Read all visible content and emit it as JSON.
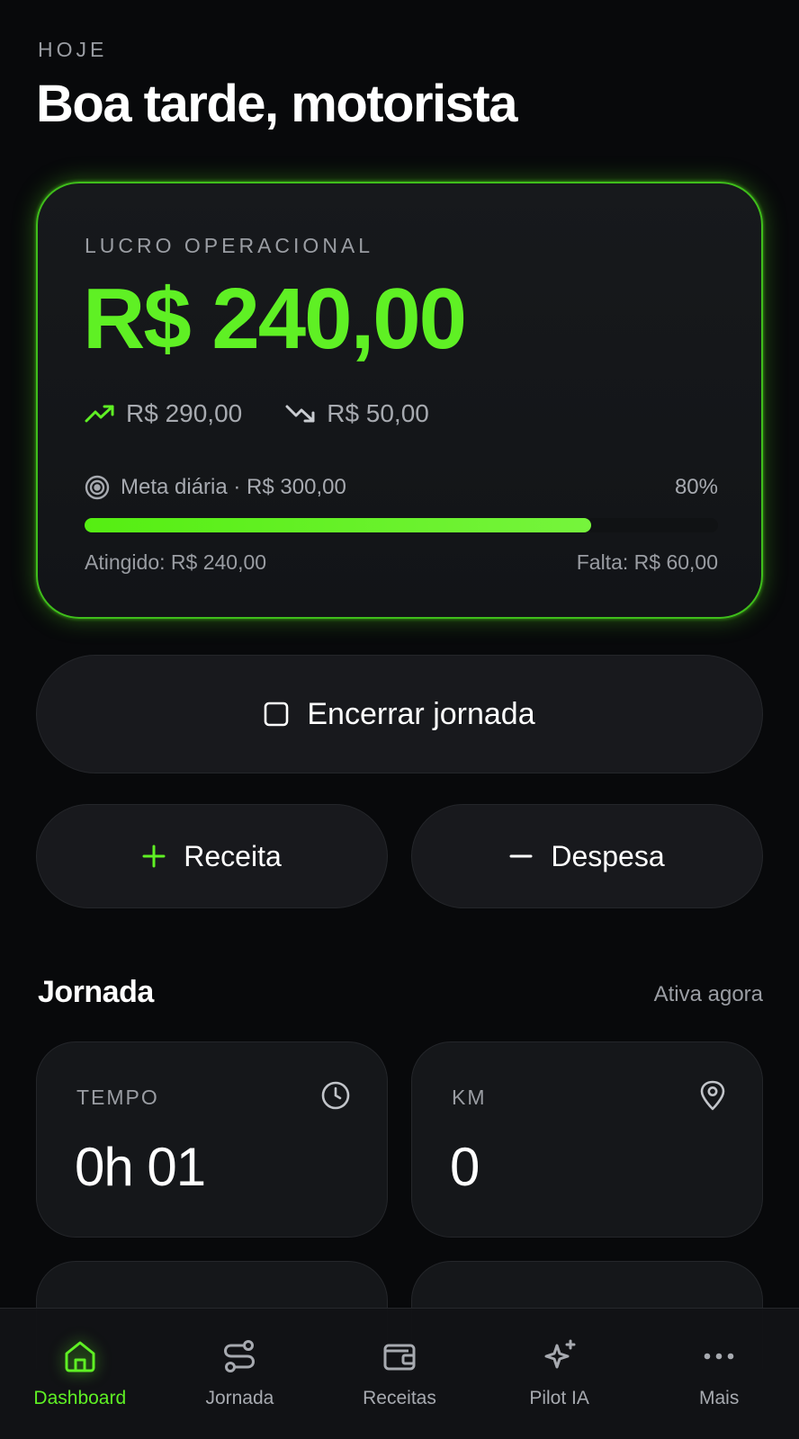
{
  "header": {
    "eyebrow": "HOJE",
    "greeting": "Boa tarde, motorista"
  },
  "profit_card": {
    "label": "LUCRO OPERACIONAL",
    "value": "R$ 240,00",
    "income": "R$ 290,00",
    "income_icon": "trending-up-icon",
    "expense": "R$ 50,00",
    "expense_icon": "trending-down-icon",
    "goal_label": "Meta diária · R$ 300,00",
    "goal_icon": "target-icon",
    "goal_percent_text": "80%",
    "goal_progress": 0.8,
    "achieved": "Atingido: R$ 240,00",
    "remaining": "Falta: R$ 60,00"
  },
  "actions": {
    "end_shift": "Encerrar jornada",
    "end_shift_icon": "stop-square-icon",
    "add_income": "Receita",
    "add_income_icon": "plus-icon",
    "add_expense": "Despesa",
    "add_expense_icon": "minus-icon"
  },
  "shift": {
    "title": "Jornada",
    "status": "Ativa agora",
    "stats": [
      {
        "label": "TEMPO",
        "value": "0h 01",
        "icon": "clock-icon"
      },
      {
        "label": "KM",
        "value": "0",
        "icon": "map-pin-icon"
      }
    ]
  },
  "nav": {
    "items": [
      {
        "label": "Dashboard",
        "icon": "home-icon",
        "active": true
      },
      {
        "label": "Jornada",
        "icon": "route-icon",
        "active": false
      },
      {
        "label": "Receitas",
        "icon": "wallet-icon",
        "active": false
      },
      {
        "label": "Pilot IA",
        "icon": "sparkles-icon",
        "active": false
      },
      {
        "label": "Mais",
        "icon": "more-dots-icon",
        "active": false
      }
    ]
  },
  "colors": {
    "accent": "#5ff024",
    "background": "#08090b",
    "card": "#17191c",
    "muted_text": "#9a9da3"
  }
}
